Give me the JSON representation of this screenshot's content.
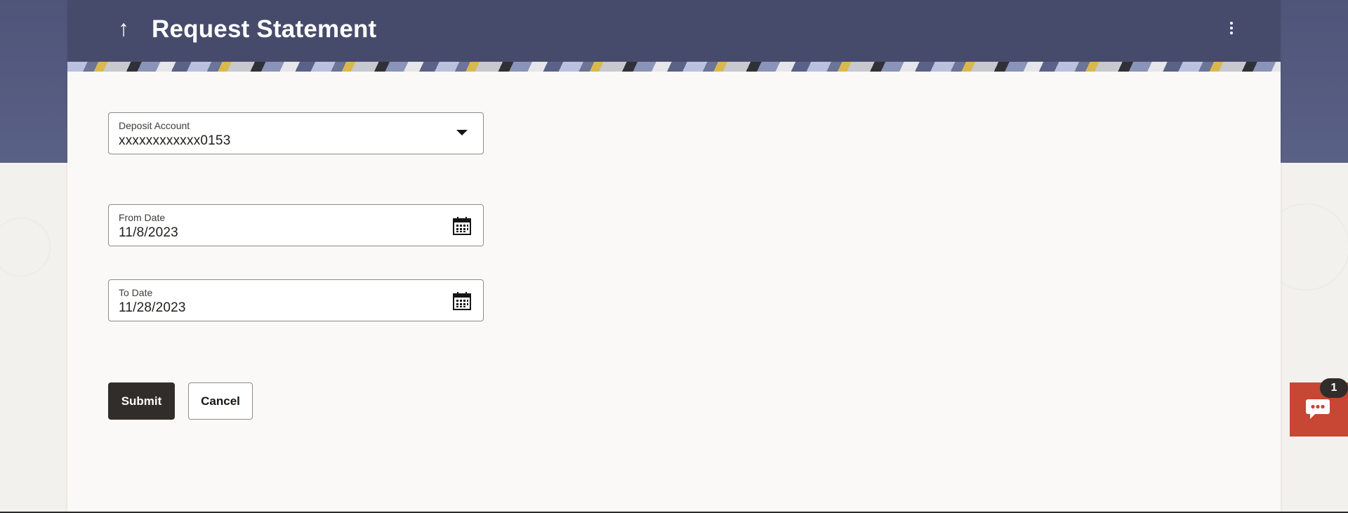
{
  "header": {
    "back_icon": "arrow-up-icon",
    "back_glyph": "↑",
    "title": "Request Statement",
    "menu_icon": "kebab-menu-icon"
  },
  "form": {
    "deposit_account": {
      "label": "Deposit Account",
      "value": "xxxxxxxxxxxx0153",
      "icon": "chevron-down-icon"
    },
    "from_date": {
      "label": "From Date",
      "value": "11/8/2023",
      "icon": "calendar-icon"
    },
    "to_date": {
      "label": "To Date",
      "value": "11/28/2023",
      "icon": "calendar-icon"
    }
  },
  "actions": {
    "submit_label": "Submit",
    "cancel_label": "Cancel"
  },
  "chat": {
    "icon": "chat-bubble-icon",
    "badge_count": "1"
  },
  "colors": {
    "header_bg": "#474b6b",
    "primary_button": "#312d2a",
    "chat_widget": "#c74634"
  }
}
